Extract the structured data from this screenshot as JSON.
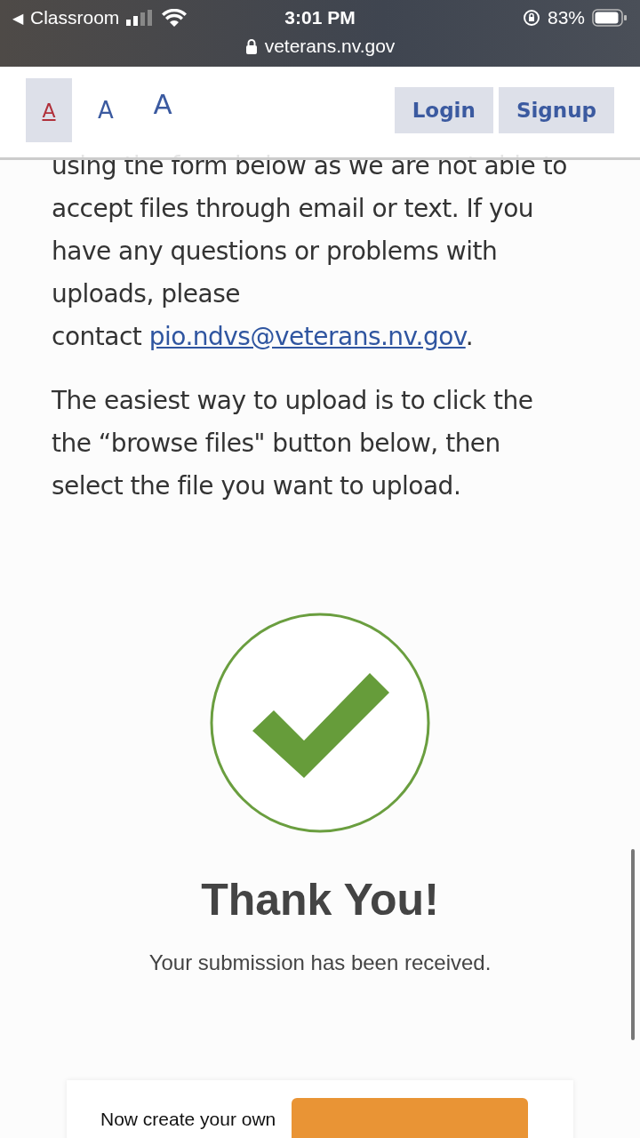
{
  "status_bar": {
    "back_icon": "◀",
    "back_label": "Classroom",
    "time": "3:01 PM",
    "battery": "83%",
    "url": "veterans.nv.gov"
  },
  "header": {
    "text_sizes": [
      {
        "label": "A",
        "selected": true
      },
      {
        "label": "A",
        "selected": false
      },
      {
        "label": "A",
        "selected": false
      }
    ],
    "buttons": [
      "Login",
      "Signup"
    ]
  },
  "intro": {
    "text": "using the form below as we are not able to accept files through email or text. If you have any questions or problems with uploads, please",
    "contact_prefix": "contact",
    "email": "pio.ndvs@veterans.nv.gov",
    "suffix": "."
  },
  "instructions": "The easiest way to upload is to click the the “browse files\" button below, then select the file you want to upload.",
  "confirmation": {
    "title": "Thank You!",
    "message": "Your submission has been received."
  },
  "promo": {
    "text": "Now create your own"
  }
}
